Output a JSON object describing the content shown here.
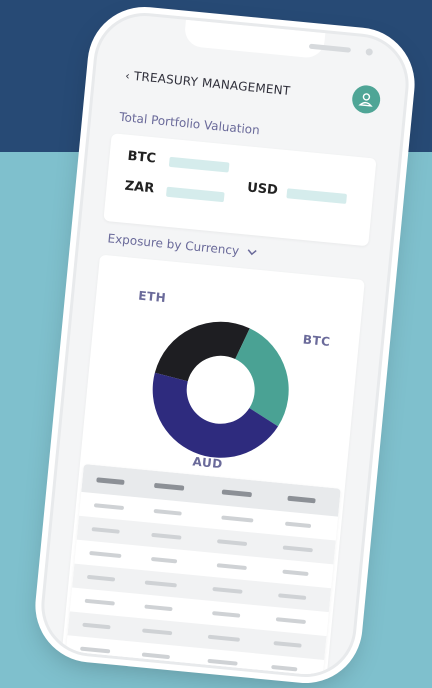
{
  "header": {
    "back_label": "TREASURY MANAGEMENT"
  },
  "portfolio": {
    "title": "Total Portfolio Valuation",
    "labels": [
      "BTC",
      "ZAR",
      "USD"
    ]
  },
  "exposure": {
    "title": "Exposure by Currency",
    "dropdown_icon": "chevron-down-icon"
  },
  "chart_data": {
    "type": "pie",
    "categories": [
      "ETH",
      "BTC",
      "AUD"
    ],
    "values": [
      28,
      27,
      45
    ],
    "colors": [
      "#1e1e22",
      "#4aa294",
      "#2e2b7e"
    ]
  },
  "icons": {
    "back": "chevron-left-icon",
    "avatar": "user-icon"
  }
}
